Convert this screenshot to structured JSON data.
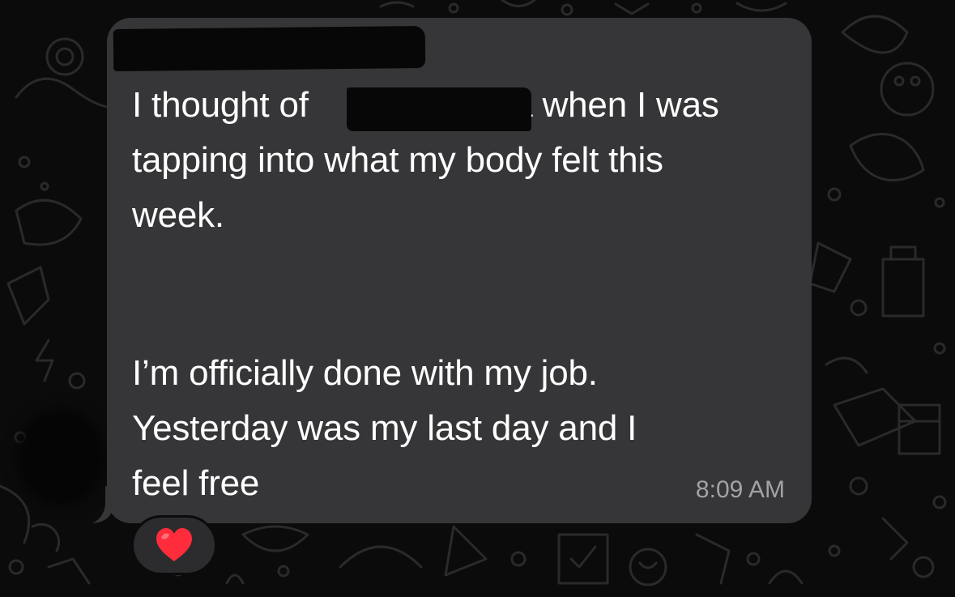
{
  "chat": {
    "message": {
      "paragraph_1": "I thought of                     a when I was\ntapping into what my body felt this\nweek.",
      "paragraph_2": "I’m officially done with my job.\nYesterday was my last day and I\nfeel free",
      "timestamp": "8:09 AM"
    },
    "reaction": {
      "icon": "heart-icon",
      "color": "#ff2d3c"
    }
  },
  "theme": {
    "background": "#0b0b0b",
    "bubble": "#363638",
    "text": "#ffffff",
    "timestamp_text": "#a3a3a6"
  }
}
